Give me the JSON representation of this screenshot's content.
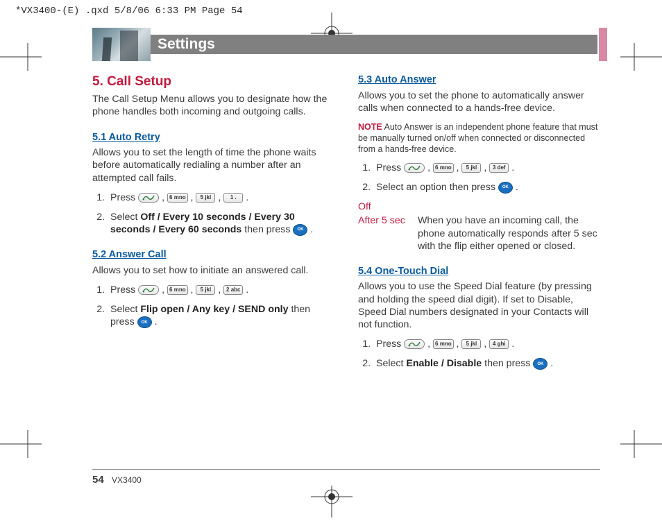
{
  "qxd_header": "*VX3400-(E) .qxd  5/8/06  6:33 PM  Page 54",
  "title": "Settings",
  "section": {
    "heading": "5. Call Setup",
    "intro": "The Call Setup Menu allows you to designate how the phone handles both incoming and outgoing calls."
  },
  "sub51": {
    "heading": "5.1 Auto Retry",
    "desc": "Allows you to set the length of time the phone waits before automatically redialing a number after an attempted call fails.",
    "step1_prefix": "Press ",
    "step1_keys": [
      "send",
      "6 mno",
      "5 jkl",
      "1 ."
    ],
    "step2_prefix": "Select ",
    "step2_opts": "Off / Every 10 seconds / Every 30 seconds / Every 60 seconds",
    "step2_suffix": "  then press ",
    "step2_keys": [
      "OK"
    ]
  },
  "sub52": {
    "heading": "5.2 Answer Call",
    "desc": "Allows you to set how to initiate an answered call.",
    "step1_prefix": "Press ",
    "step1_keys": [
      "send",
      "6 mno",
      "5 jkl",
      "2 abc"
    ],
    "step2_prefix": "Select ",
    "step2_opts": "Flip open / Any key / SEND only",
    "step2_mid": " then press ",
    "step2_keys": [
      "OK"
    ]
  },
  "sub53": {
    "heading": "5.3 Auto Answer",
    "desc": "Allows you to set the phone to automatically answer calls when connected to a hands-free device.",
    "note_label": "NOTE",
    "note_text": " Auto Answer is an independent phone feature that must be manually turned on/off when connected or disconnected from a hands-free device.",
    "step1_prefix": "Press ",
    "step1_keys": [
      "send",
      "6 mno",
      "5 jkl",
      "3 def"
    ],
    "step2_prefix": "Select an option then press ",
    "step2_keys": [
      "OK"
    ],
    "opt_off": "Off",
    "opt_after5_label": "After 5 sec",
    "opt_after5_desc": "When you have an incoming call, the phone automatically responds after 5 sec with the flip either opened or closed."
  },
  "sub54": {
    "heading": "5.4 One-Touch Dial",
    "desc": "Allows you to use the Speed Dial feature (by pressing and holding the speed dial digit). If set to Disable, Speed Dial numbers designated in your Contacts will not function.",
    "step1_prefix": "Press ",
    "step1_keys": [
      "send",
      "6 mno",
      "5 jkl",
      "4 ghi"
    ],
    "step2_prefix": "Select ",
    "step2_opts": "Enable / Disable",
    "step2_mid": " then press ",
    "step2_keys": [
      "OK"
    ]
  },
  "footer": {
    "page": "54",
    "model": "VX3400"
  }
}
